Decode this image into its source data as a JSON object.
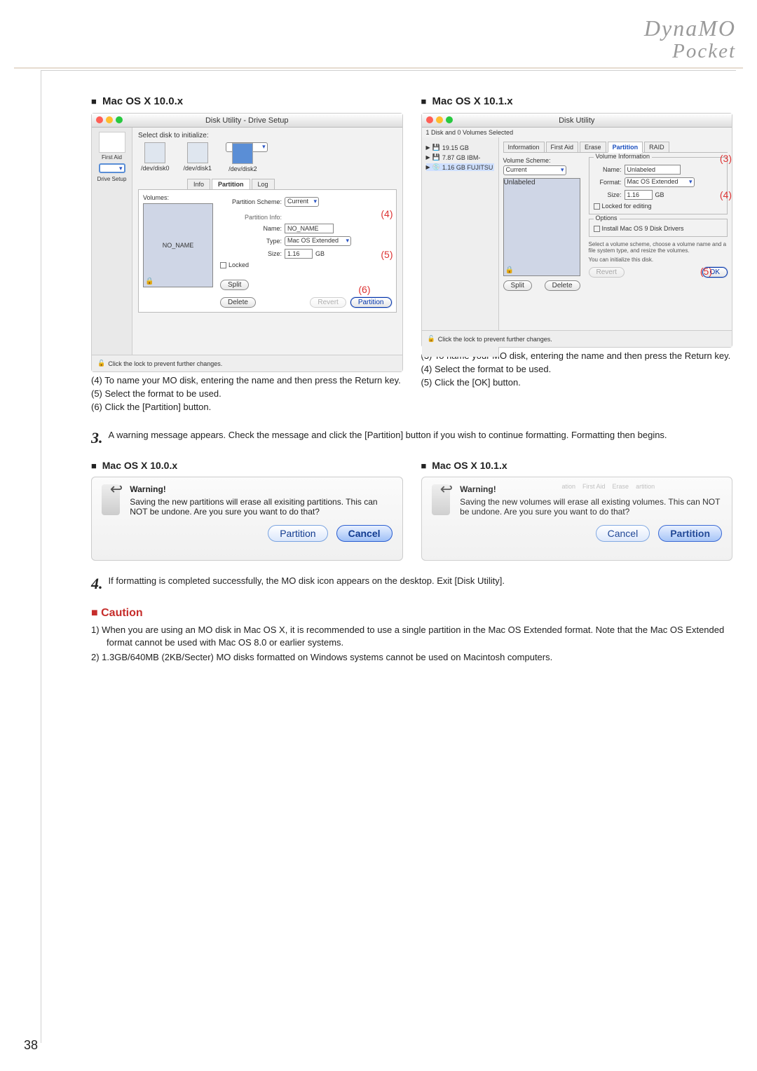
{
  "header": {
    "line1": "DynaMO",
    "line2": "Pocket"
  },
  "page_number": "38",
  "sections": {
    "left_title": "Mac OS X 10.0.x",
    "right_title": "Mac OS X 10.1.x"
  },
  "ss1": {
    "window_title": "Disk Utility - Drive Setup",
    "side_firstaid": "First Aid",
    "side_drivesetup": "Drive Setup",
    "select_label": "Select disk to initialize:",
    "disk0": "/dev/disk0",
    "disk1": "/dev/disk1",
    "disk2": "/dev/disk2",
    "tab_info": "Info",
    "tab_partition": "Partition",
    "tab_log": "Log",
    "volumes_label": "Volumes:",
    "vol_name": "NO_NAME",
    "scheme_label": "Partition Scheme:",
    "scheme_value": "Current",
    "pinfo_label": "Partition Info:",
    "name_label": "Name:",
    "name_value": "NO_NAME",
    "type_label": "Type:",
    "type_value": "Mac OS Extended",
    "size_label": "Size:",
    "size_value": "1.16",
    "size_unit": "GB",
    "locked_label": "Locked",
    "btn_split": "Split",
    "btn_delete": "Delete",
    "btn_revert": "Revert",
    "btn_partition": "Partition",
    "lock_text": "Click the lock to prevent further changes.",
    "call4": "(4)",
    "call5": "(5)",
    "call6": "(6)"
  },
  "ss1_steps": {
    "s4": "(4) To name your MO disk, entering the name and then press the Return key.",
    "s5": "(5) Select the format to be used.",
    "s6": "(6) Click the [Partition] button."
  },
  "ss2": {
    "window_title": "Disk Utility",
    "sidebar_head": "1 Disk and 0 Volumes Selected",
    "tree1": "19.15 GB",
    "tree2": "7.87 GB IBM-",
    "tree3": "1.16 GB FUJITSU",
    "tab_info": "Information",
    "tab_firstaid": "First Aid",
    "tab_erase": "Erase",
    "tab_partition": "Partition",
    "tab_raid": "RAID",
    "vscheme_label": "Volume Scheme:",
    "vscheme_value": "Current",
    "vol_name": "Unlabeled",
    "vibox_title": "Volume Information",
    "name_label": "Name:",
    "name_value": "Unlabeled",
    "format_label": "Format:",
    "format_value": "Mac OS Extended",
    "size_label": "Size:",
    "size_value": "1.16",
    "size_unit": "GB",
    "locked_label": "Locked for editing",
    "opt_title": "Options",
    "opt_checkbox": "Install Mac OS 9 Disk Drivers",
    "hint": "Select a volume scheme, choose a volume name and a file system type, and resize the volumes.",
    "hint2": "You can initialize this disk.",
    "btn_split": "Split",
    "btn_delete": "Delete",
    "btn_revert": "Revert",
    "btn_ok": "OK",
    "lock_text": "Click the lock to prevent further changes.",
    "call3": "(3)",
    "call4": "(4)",
    "call5": "(5)"
  },
  "ss2_steps": {
    "s3": "(3) To name your MO disk, entering the name and then press the Return key.",
    "s4": "(4) Select the format to be used.",
    "s5": "(5) Click the [OK] button."
  },
  "step3": {
    "num": "3.",
    "text": "A warning message appears.  Check the message and click the [Partition] button if you wish to continue formatting.  Formatting then begins."
  },
  "dlg_left": {
    "heading_label": "Mac OS X 10.0.x",
    "title": "Warning!",
    "body": "Saving the new partitions will erase all exisiting partitions.  This can NOT be undone.  Are you sure you want to do that?",
    "btn_partition": "Partition",
    "btn_cancel": "Cancel"
  },
  "dlg_right": {
    "heading_label": "Mac OS X 10.1.x",
    "title": "Warning!",
    "body": "Saving the new volumes will erase all existing volumes.  This can NOT be undone.  Are you sure you want to do that?",
    "btn_cancel": "Cancel",
    "btn_partition": "Partition",
    "ghost_tabs": [
      "ation",
      "First Aid",
      "Erase",
      "artition"
    ]
  },
  "step4": {
    "num": "4.",
    "text": "If formatting is completed successfully, the MO disk icon appears on the desktop.  Exit [Disk Utility]."
  },
  "caution": {
    "title": "Caution",
    "c1": "1)  When you are using an MO disk in Mac OS X, it is recommended to use a single partition in the Mac OS Extended format.  Note that the Mac OS Extended format cannot be used with Mac OS 8.0 or earlier systems.",
    "c2": "2)  1.3GB/640MB (2KB/Secter) MO disks formatted on Windows systems cannot be used on Macintosh computers."
  }
}
